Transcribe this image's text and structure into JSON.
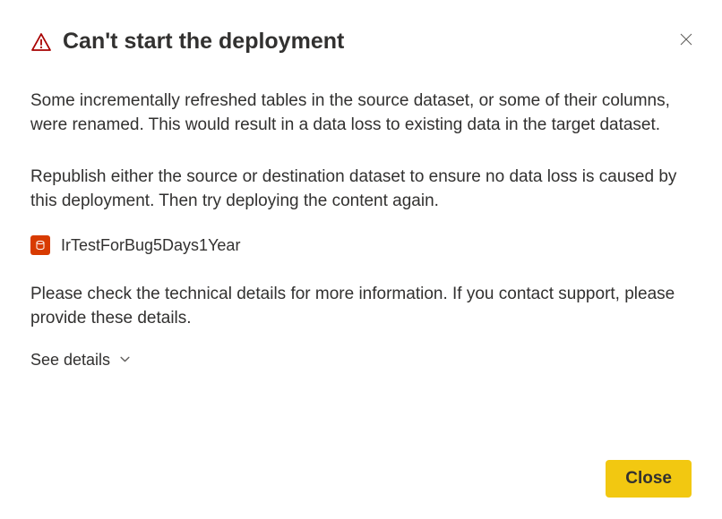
{
  "dialog": {
    "title": "Can't start the deployment",
    "paragraph1": "Some incrementally refreshed tables in the source dataset, or some of their columns, were renamed. This would result in a data loss to existing data in the target dataset.",
    "paragraph2": "Republish either the source or destination dataset to ensure no data loss is caused by this deployment. Then try deploying the content again.",
    "dataset_name": "IrTestForBug5Days1Year",
    "paragraph3": "Please check the technical details for more information. If you contact support, please provide these details.",
    "see_details_label": "See details",
    "close_button_label": "Close"
  },
  "colors": {
    "warning": "#a80000",
    "dataset_icon_bg": "#d83b01",
    "primary_button_bg": "#f2c811"
  }
}
